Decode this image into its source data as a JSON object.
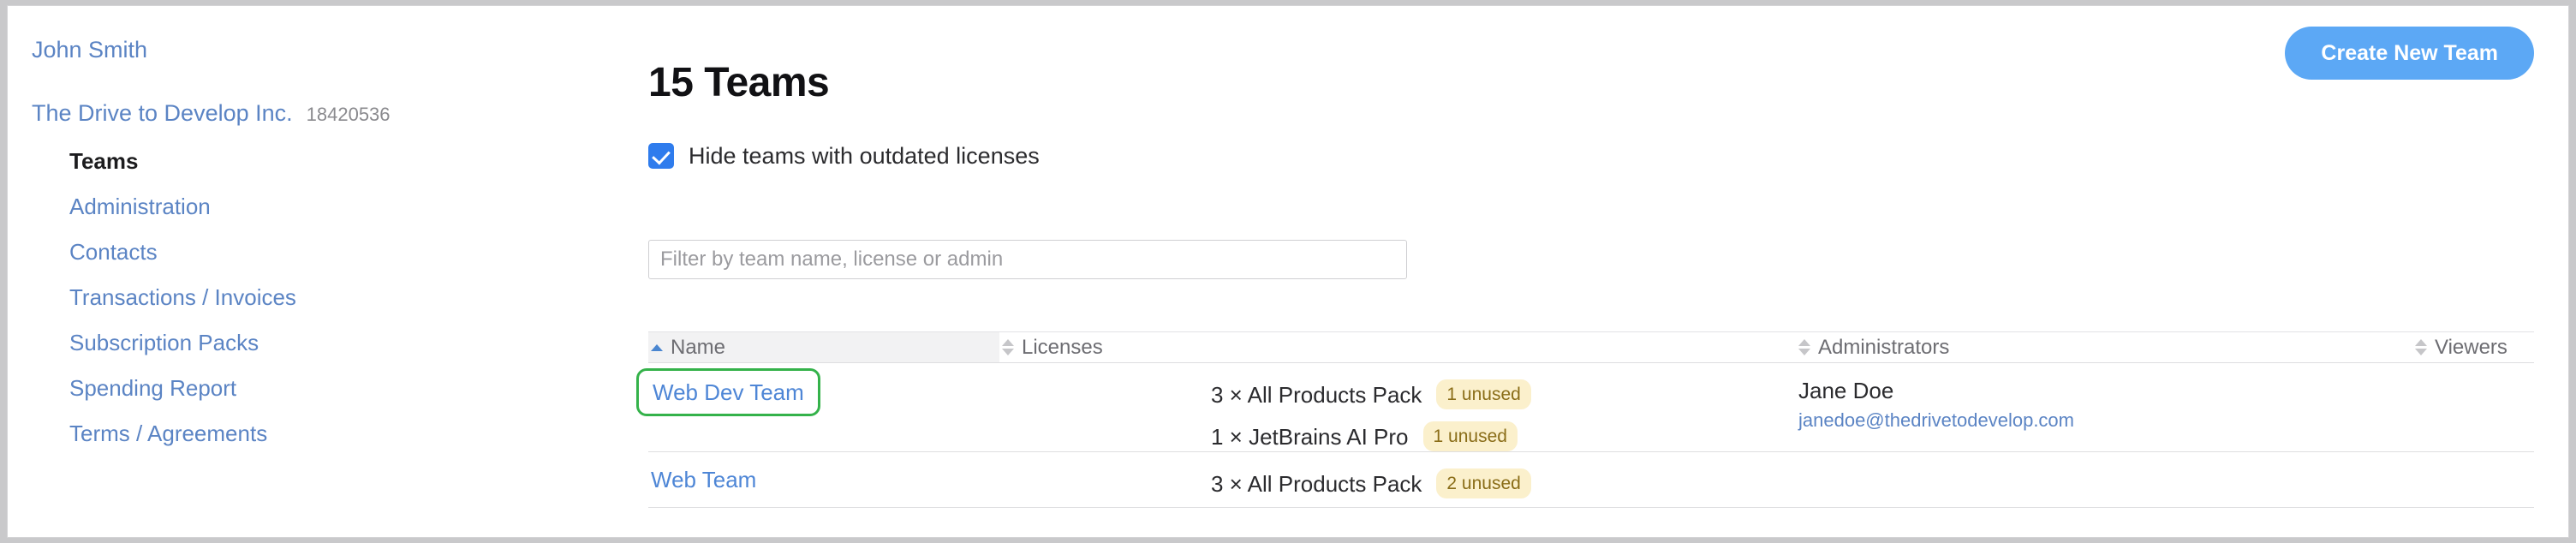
{
  "sidebar": {
    "user": "John Smith",
    "org_name": "The Drive to Develop Inc.",
    "org_id": "18420536",
    "items": [
      {
        "label": "Teams",
        "active": true
      },
      {
        "label": "Administration",
        "active": false
      },
      {
        "label": "Contacts",
        "active": false
      },
      {
        "label": "Transactions / Invoices",
        "active": false
      },
      {
        "label": "Subscription Packs",
        "active": false
      },
      {
        "label": "Spending Report",
        "active": false
      },
      {
        "label": "Terms / Agreements",
        "active": false
      }
    ]
  },
  "main": {
    "title": "15 Teams",
    "create_button": "Create New Team",
    "hide_outdated": {
      "label": "Hide teams with outdated licenses",
      "checked": true
    },
    "filter": {
      "value": "",
      "placeholder": "Filter by team name, license or admin"
    },
    "table": {
      "columns": [
        {
          "label": "Name",
          "sort": "asc"
        },
        {
          "label": "Licenses",
          "sort": "none"
        },
        {
          "label": "Administrators",
          "sort": "none"
        },
        {
          "label": "Viewers",
          "sort": "none"
        }
      ],
      "rows": [
        {
          "name": "Web Dev Team",
          "highlighted": true,
          "licenses": [
            {
              "text": "3 × All Products Pack",
              "badge": "1 unused"
            },
            {
              "text": "1 × JetBrains AI Pro",
              "badge": "1 unused"
            }
          ],
          "administrators": [
            {
              "name": "Jane Doe",
              "email": "janedoe@thedrivetodevelop.com"
            }
          ],
          "viewers": ""
        },
        {
          "name": "Web Team",
          "highlighted": false,
          "licenses": [
            {
              "text": "3 × All Products Pack",
              "badge": "2 unused"
            }
          ],
          "administrators": [],
          "viewers": ""
        }
      ]
    }
  },
  "colors": {
    "link": "#5b84c4",
    "accent": "#5ca8f5",
    "checkbox": "#2f7ced",
    "badge_bg": "#fbf0cc",
    "badge_text": "#8a6d18",
    "highlight_outline": "#34b24a",
    "sort_active": "#4a86d0"
  }
}
